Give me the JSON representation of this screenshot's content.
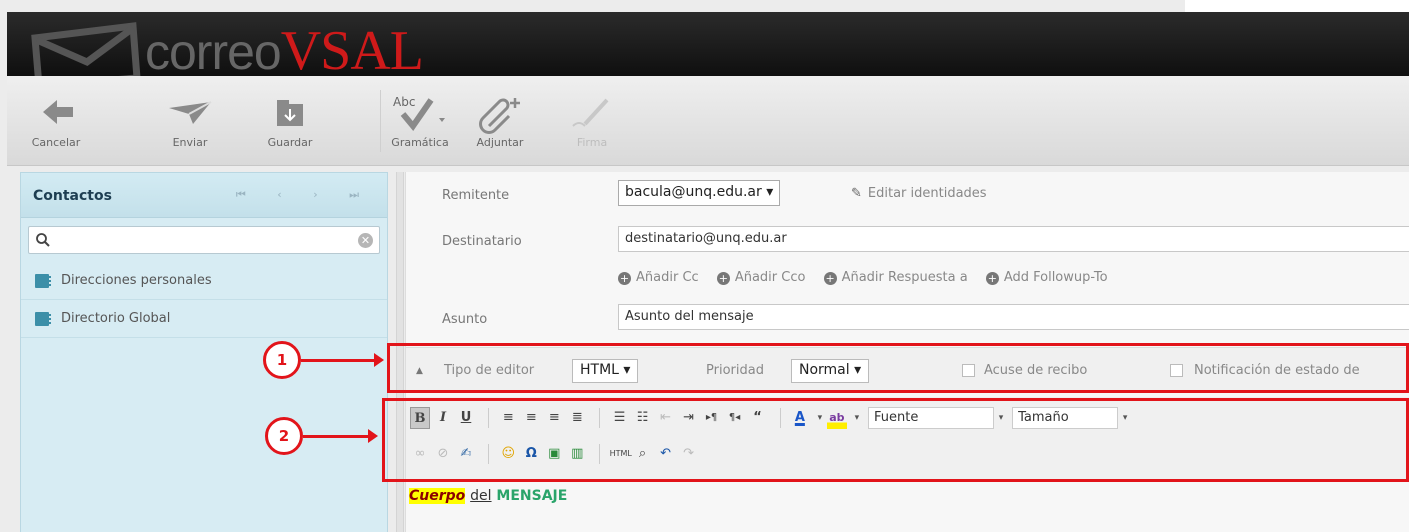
{
  "app": {
    "logo_part1": "correo",
    "logo_part2": "VSAL"
  },
  "toolbar": {
    "buttons": [
      {
        "label": "Cancelar",
        "icon": "arrow-left-icon"
      },
      {
        "label": "Enviar",
        "icon": "paper-plane-icon"
      },
      {
        "label": "Guardar",
        "icon": "save-folder-icon"
      },
      {
        "label": "Gramática",
        "icon": "spellcheck-icon"
      },
      {
        "label": "Adjuntar",
        "icon": "paperclip-plus-icon"
      },
      {
        "label": "Firma",
        "icon": "signature-pen-icon",
        "disabled": true
      }
    ],
    "spell_badge": "Abc"
  },
  "contacts": {
    "title": "Contactos",
    "pager": "⏮ ‹ › ⏭",
    "search_placeholder": "",
    "address_books": [
      {
        "label": "Direcciones personales"
      },
      {
        "label": "Directorio Global"
      }
    ]
  },
  "compose": {
    "from_label": "Remitente",
    "from_value": "bacula@unq.edu.ar ▾",
    "edit_identities": "Editar identidades",
    "to_label": "Destinatario",
    "to_value": "destinatario@unq.edu.ar",
    "add_links": [
      "Añadir Cc",
      "Añadir Cco",
      "Añadir Respuesta a",
      "Add Followup-To"
    ],
    "subject_label": "Asunto",
    "subject_value": "Asunto del mensaje"
  },
  "options": {
    "editor_type_label": "Tipo de editor",
    "editor_type_value": "HTML ▾",
    "priority_label": "Prioridad",
    "priority_value": "Normal ▾",
    "receipt_label": "Acuse de recibo",
    "status_label": "Notificación de estado de"
  },
  "editor": {
    "font_label": "Fuente",
    "size_label": "Tamaño",
    "body_w1": "Cuerpo",
    "body_w2": "del",
    "body_w3": "MENSAJE"
  },
  "annotations": {
    "one": "1",
    "two": "2"
  },
  "colors": {
    "accent_red": "#e2141a",
    "logo_red": "#cf1a1a",
    "panel_blue": "#d7ecf3",
    "body_green": "#2aa46a"
  }
}
